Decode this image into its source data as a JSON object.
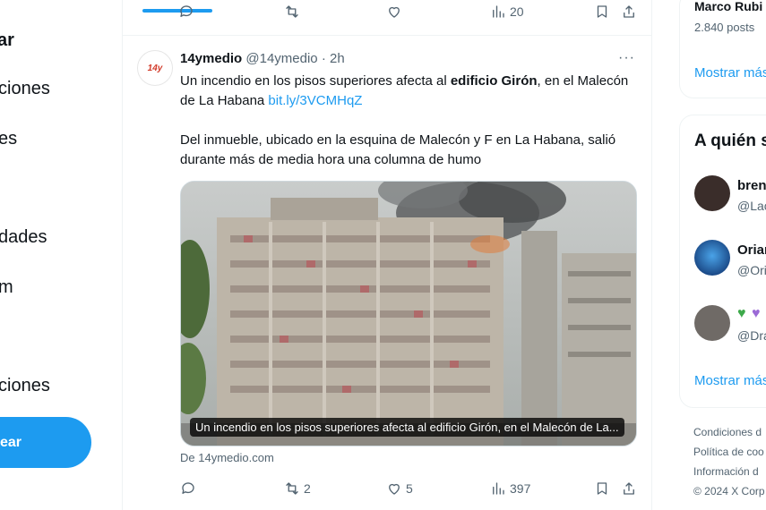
{
  "nav": {
    "items": [
      "ar",
      "ciones",
      "es",
      "dades",
      "m",
      "ciones"
    ],
    "post_label": "ear"
  },
  "top_actions": {
    "views": "20"
  },
  "tweet": {
    "name": "14ymedio",
    "handle": "@14ymedio",
    "time": "· 2h",
    "more": "···",
    "avatar_text": "14y",
    "text1_a": "Un incendio en los pisos superiores afecta al ",
    "text1_b": "edificio Girón",
    "text1_c": ", en el Malecón de La Habana ",
    "text1_link": "bit.ly/3VCMHqZ",
    "text2": "Del inmueble, ubicado en la esquina de Malecón y F en La Habana, salió durante más de media hora una columna de humo",
    "caption": "Un incendio en los pisos superiores afecta al edificio Girón, en el Malecón de La...",
    "source": "De 14ymedio.com",
    "retweets": "2",
    "likes": "5",
    "views": "397"
  },
  "right": {
    "trend_name": "Marco Rubi",
    "trend_posts": "2.840 posts",
    "show_more_1": "Mostrar más",
    "who_title": "A quién s",
    "follow": [
      {
        "name": "bren",
        "handle": "@Lac"
      },
      {
        "name": "Orian",
        "handle": "@Ori"
      },
      {
        "name": "",
        "handle": "@Dra"
      }
    ],
    "show_more_2": "Mostrar más",
    "footer": [
      "Condiciones d",
      "Política de coo",
      "Información d",
      "© 2024 X Corp"
    ]
  },
  "colors": {
    "accent": "#1d9bf0",
    "muted": "#536471",
    "text": "#0f1419"
  }
}
